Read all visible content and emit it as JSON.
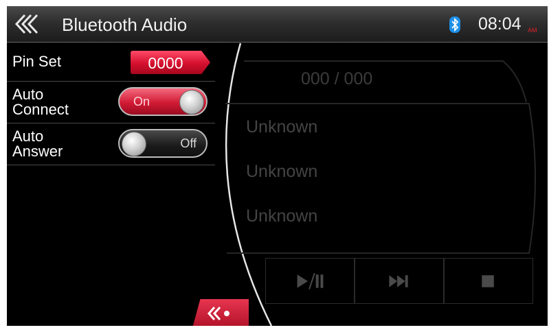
{
  "header": {
    "title": "Bluetooth Audio",
    "time": "08:04",
    "ampm": "AM",
    "icons": {
      "back": "triple-chevron-left-icon",
      "bluetooth": "bluetooth-icon"
    }
  },
  "settings": {
    "pin": {
      "label": "Pin Set",
      "value": "0000"
    },
    "auto_connect": {
      "label_line1": "Auto",
      "label_line2": "Connect",
      "state": "On"
    },
    "auto_answer": {
      "label_line1": "Auto",
      "label_line2": "Answer",
      "state": "Off"
    }
  },
  "player": {
    "track_count": "000 / 000",
    "meta": [
      "Unknown",
      "Unknown",
      "Unknown"
    ],
    "controls": [
      "play-pause-icon",
      "next-track-icon",
      "stop-icon"
    ]
  },
  "colors": {
    "accent": "#d4102e",
    "background": "#000000",
    "text": "#ffffff",
    "dim_text": "#444444"
  }
}
